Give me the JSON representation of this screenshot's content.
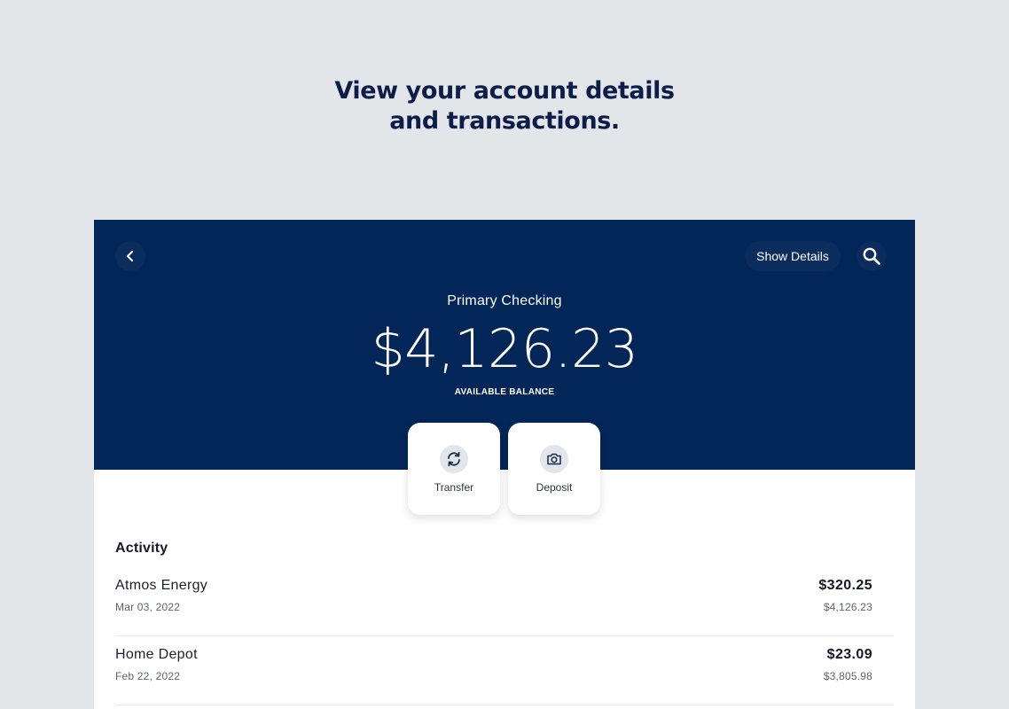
{
  "headline": {
    "line1": "View your account details",
    "line2": "and transactions."
  },
  "header": {
    "back_icon": "chevron-left-icon",
    "show_details_label": "Show Details",
    "search_icon": "search-icon"
  },
  "account": {
    "name": "Primary Checking",
    "balance": "$4,126.23",
    "balance_label": "AVAILABLE BALANCE"
  },
  "actions": [
    {
      "label": "Transfer",
      "icon": "transfer-icon"
    },
    {
      "label": "Deposit",
      "icon": "camera-icon"
    }
  ],
  "activity": {
    "title": "Activity",
    "transactions": [
      {
        "merchant": "Atmos Energy",
        "date": "Mar 03, 2022",
        "amount": "$320.25",
        "balance_after": "$4,126.23"
      },
      {
        "merchant": "Home Depot",
        "date": "Feb 22, 2022",
        "amount": "$23.09",
        "balance_after": "$3,805.98"
      }
    ]
  },
  "colors": {
    "page_background": "#e3e6e9",
    "hero_background": "#022658",
    "headline_text": "#0c1d4a",
    "card_background": "#ffffff"
  }
}
